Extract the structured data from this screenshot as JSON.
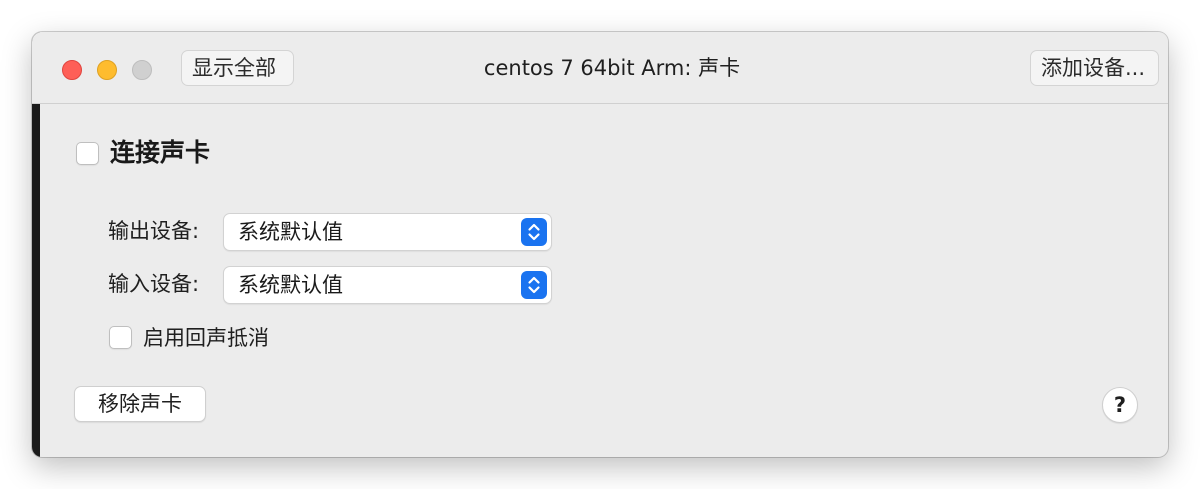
{
  "window": {
    "title": "centos 7 64bit Arm: 声卡"
  },
  "toolbar": {
    "show_all_label": "显示全部",
    "add_device_label": "添加设备..."
  },
  "sound_card": {
    "connect_label": "连接声卡",
    "connect_checked": false,
    "output": {
      "label": "输出设备:",
      "value": "系统默认值"
    },
    "input": {
      "label": "输入设备:",
      "value": "系统默认值"
    },
    "echo_cancel_label": "启用回声抵消",
    "echo_cancel_checked": false,
    "remove_label": "移除声卡",
    "help_label": "?"
  },
  "icons": {
    "close": "close-icon",
    "minimize": "minimize-icon",
    "zoom": "zoom-icon",
    "stepper": "chevron-up-down-icon",
    "help": "question-mark-icon"
  },
  "colors": {
    "close": "#fe5f57",
    "minimize": "#febc2e",
    "zoom_disabled": "#d0d0d0",
    "accent": "#1a73f0",
    "window_bg": "#ececec"
  }
}
